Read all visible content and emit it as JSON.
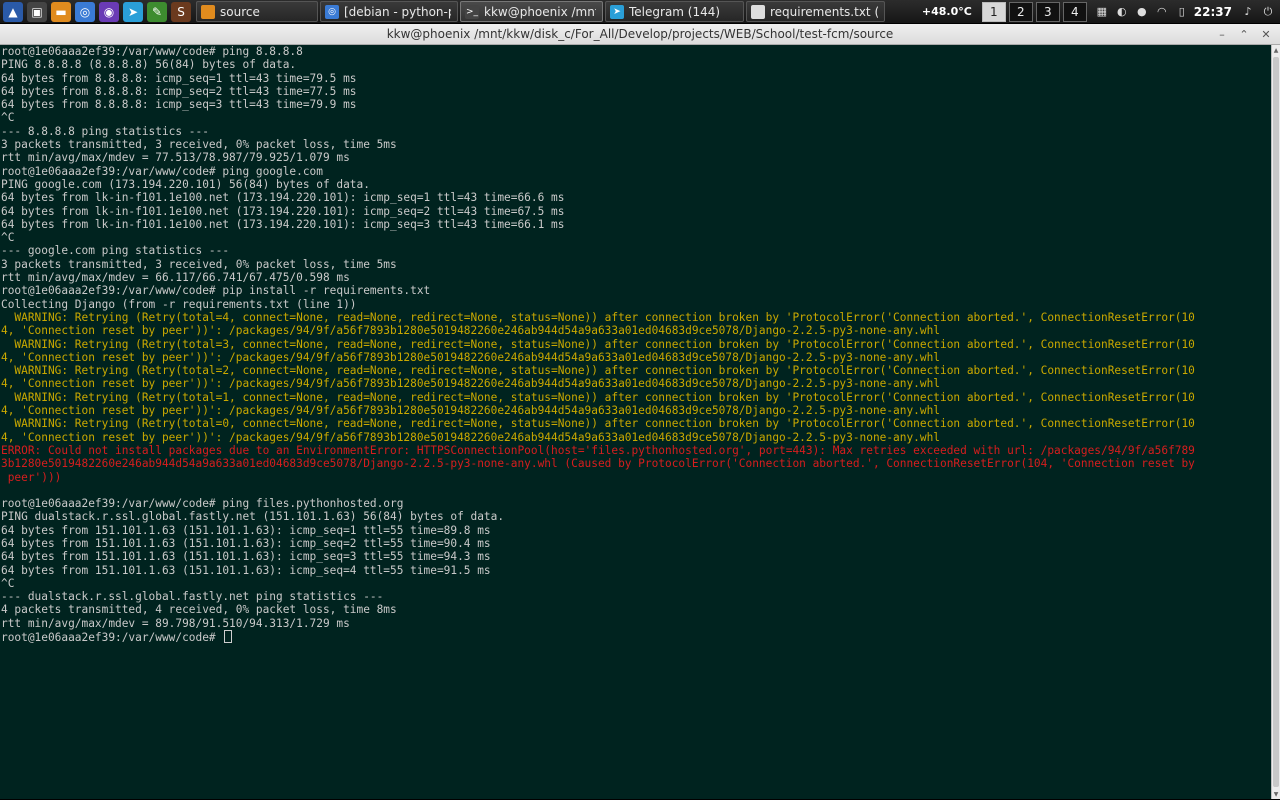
{
  "panel": {
    "launchers": [
      {
        "name": "menu-icon",
        "glyph": "▲",
        "color": "#2a5aa8"
      },
      {
        "name": "terminal-launcher-icon",
        "glyph": "▣",
        "color": "#444444"
      },
      {
        "name": "folder-icon",
        "glyph": "▬",
        "color": "#e08b1e"
      },
      {
        "name": "chromium-icon",
        "glyph": "◎",
        "color": "#3a7bd5"
      },
      {
        "name": "firefox-icon",
        "glyph": "◉",
        "color": "#6a3bb5"
      },
      {
        "name": "telegram-icon",
        "glyph": "➤",
        "color": "#2a9fd8"
      },
      {
        "name": "editor-icon",
        "glyph": "✎",
        "color": "#3d8c2f"
      },
      {
        "name": "sublime-icon",
        "glyph": "S",
        "color": "#6b3a1e"
      }
    ],
    "tasks": [
      {
        "name": "task-source",
        "label": "source",
        "icon": "folder-icon",
        "icon_color": "#e08b1e",
        "glyph": "",
        "active": false
      },
      {
        "name": "task-debian-python-pip",
        "label": "[debian - python-pip ...",
        "icon": "chromium-icon",
        "icon_color": "#3a7bd5",
        "glyph": "◎",
        "active": false
      },
      {
        "name": "task-terminal",
        "label": "kkw@phoenix /mnt/k...",
        "icon": "terminal-icon",
        "icon_color": "#444444",
        "glyph": ">_",
        "active": true
      },
      {
        "name": "task-telegram",
        "label": "Telegram (144)",
        "icon": "telegram-icon",
        "icon_color": "#2a9fd8",
        "glyph": "➤",
        "active": false
      },
      {
        "name": "task-requirements",
        "label": "requirements.txt (~/...",
        "icon": "document-icon",
        "icon_color": "#dddddd",
        "glyph": "",
        "active": false
      }
    ],
    "temperature": "+48.0°C",
    "workspaces": [
      "1",
      "2",
      "3",
      "4"
    ],
    "current_workspace": "1",
    "tray": [
      {
        "name": "flag-us-icon",
        "glyph": "▦"
      },
      {
        "name": "network-icon",
        "glyph": "◐"
      },
      {
        "name": "user-icon",
        "glyph": "●"
      },
      {
        "name": "wifi-icon",
        "glyph": "◠"
      },
      {
        "name": "battery-icon",
        "glyph": "▯"
      }
    ],
    "clock": "22:37",
    "tray_end": [
      {
        "name": "music-icon",
        "glyph": "♪"
      },
      {
        "name": "power-icon",
        "glyph": "⏻"
      }
    ]
  },
  "window": {
    "title": "kkw@phoenix /mnt/kkw/disk_c/For_All/Develop/projects/WEB/School/test-fcm/source",
    "minimize_glyph": "–",
    "maximize_glyph": "⌃",
    "close_glyph": "✕"
  },
  "terminal": {
    "lines": [
      {
        "text": "root@1e06aaa2ef39:/var/www/code# ping 8.8.8.8",
        "kind": "normal"
      },
      {
        "text": "PING 8.8.8.8 (8.8.8.8) 56(84) bytes of data.",
        "kind": "normal"
      },
      {
        "text": "64 bytes from 8.8.8.8: icmp_seq=1 ttl=43 time=79.5 ms",
        "kind": "normal"
      },
      {
        "text": "64 bytes from 8.8.8.8: icmp_seq=2 ttl=43 time=77.5 ms",
        "kind": "normal"
      },
      {
        "text": "64 bytes from 8.8.8.8: icmp_seq=3 ttl=43 time=79.9 ms",
        "kind": "normal"
      },
      {
        "text": "^C",
        "kind": "normal"
      },
      {
        "text": "--- 8.8.8.8 ping statistics ---",
        "kind": "normal"
      },
      {
        "text": "3 packets transmitted, 3 received, 0% packet loss, time 5ms",
        "kind": "normal"
      },
      {
        "text": "rtt min/avg/max/mdev = 77.513/78.987/79.925/1.079 ms",
        "kind": "normal"
      },
      {
        "text": "root@1e06aaa2ef39:/var/www/code# ping google.com",
        "kind": "normal"
      },
      {
        "text": "PING google.com (173.194.220.101) 56(84) bytes of data.",
        "kind": "normal"
      },
      {
        "text": "64 bytes from lk-in-f101.1e100.net (173.194.220.101): icmp_seq=1 ttl=43 time=66.6 ms",
        "kind": "normal"
      },
      {
        "text": "64 bytes from lk-in-f101.1e100.net (173.194.220.101): icmp_seq=2 ttl=43 time=67.5 ms",
        "kind": "normal"
      },
      {
        "text": "64 bytes from lk-in-f101.1e100.net (173.194.220.101): icmp_seq=3 ttl=43 time=66.1 ms",
        "kind": "normal"
      },
      {
        "text": "^C",
        "kind": "normal"
      },
      {
        "text": "--- google.com ping statistics ---",
        "kind": "normal"
      },
      {
        "text": "3 packets transmitted, 3 received, 0% packet loss, time 5ms",
        "kind": "normal"
      },
      {
        "text": "rtt min/avg/max/mdev = 66.117/66.741/67.475/0.598 ms",
        "kind": "normal"
      },
      {
        "text": "root@1e06aaa2ef39:/var/www/code# pip install -r requirements.txt",
        "kind": "normal"
      },
      {
        "text": "Collecting Django (from -r requirements.txt (line 1))",
        "kind": "normal"
      },
      {
        "text": "  WARNING: Retrying (Retry(total=4, connect=None, read=None, redirect=None, status=None)) after connection broken by 'ProtocolError('Connection aborted.', ConnectionResetError(10",
        "kind": "warn"
      },
      {
        "text": "4, 'Connection reset by peer'))': /packages/94/9f/a56f7893b1280e5019482260e246ab944d54a9a633a01ed04683d9ce5078/Django-2.2.5-py3-none-any.whl",
        "kind": "warn"
      },
      {
        "text": "  WARNING: Retrying (Retry(total=3, connect=None, read=None, redirect=None, status=None)) after connection broken by 'ProtocolError('Connection aborted.', ConnectionResetError(10",
        "kind": "warn"
      },
      {
        "text": "4, 'Connection reset by peer'))': /packages/94/9f/a56f7893b1280e5019482260e246ab944d54a9a633a01ed04683d9ce5078/Django-2.2.5-py3-none-any.whl",
        "kind": "warn"
      },
      {
        "text": "  WARNING: Retrying (Retry(total=2, connect=None, read=None, redirect=None, status=None)) after connection broken by 'ProtocolError('Connection aborted.', ConnectionResetError(10",
        "kind": "warn"
      },
      {
        "text": "4, 'Connection reset by peer'))': /packages/94/9f/a56f7893b1280e5019482260e246ab944d54a9a633a01ed04683d9ce5078/Django-2.2.5-py3-none-any.whl",
        "kind": "warn"
      },
      {
        "text": "  WARNING: Retrying (Retry(total=1, connect=None, read=None, redirect=None, status=None)) after connection broken by 'ProtocolError('Connection aborted.', ConnectionResetError(10",
        "kind": "warn"
      },
      {
        "text": "4, 'Connection reset by peer'))': /packages/94/9f/a56f7893b1280e5019482260e246ab944d54a9a633a01ed04683d9ce5078/Django-2.2.5-py3-none-any.whl",
        "kind": "warn"
      },
      {
        "text": "  WARNING: Retrying (Retry(total=0, connect=None, read=None, redirect=None, status=None)) after connection broken by 'ProtocolError('Connection aborted.', ConnectionResetError(10",
        "kind": "warn"
      },
      {
        "text": "4, 'Connection reset by peer'))': /packages/94/9f/a56f7893b1280e5019482260e246ab944d54a9a633a01ed04683d9ce5078/Django-2.2.5-py3-none-any.whl",
        "kind": "warn"
      },
      {
        "text": "ERROR: Could not install packages due to an EnvironmentError: HTTPSConnectionPool(host='files.pythonhosted.org', port=443): Max retries exceeded with url: /packages/94/9f/a56f789",
        "kind": "err"
      },
      {
        "text": "3b1280e5019482260e246ab944d54a9a633a01ed04683d9ce5078/Django-2.2.5-py3-none-any.whl (Caused by ProtocolError('Connection aborted.', ConnectionResetError(104, 'Connection reset by",
        "kind": "err"
      },
      {
        "text": " peer')))",
        "kind": "err"
      },
      {
        "text": "",
        "kind": "normal"
      },
      {
        "text": "root@1e06aaa2ef39:/var/www/code# ping files.pythonhosted.org",
        "kind": "normal"
      },
      {
        "text": "PING dualstack.r.ssl.global.fastly.net (151.101.1.63) 56(84) bytes of data.",
        "kind": "normal"
      },
      {
        "text": "64 bytes from 151.101.1.63 (151.101.1.63): icmp_seq=1 ttl=55 time=89.8 ms",
        "kind": "normal"
      },
      {
        "text": "64 bytes from 151.101.1.63 (151.101.1.63): icmp_seq=2 ttl=55 time=90.4 ms",
        "kind": "normal"
      },
      {
        "text": "64 bytes from 151.101.1.63 (151.101.1.63): icmp_seq=3 ttl=55 time=94.3 ms",
        "kind": "normal"
      },
      {
        "text": "64 bytes from 151.101.1.63 (151.101.1.63): icmp_seq=4 ttl=55 time=91.5 ms",
        "kind": "normal"
      },
      {
        "text": "^C",
        "kind": "normal"
      },
      {
        "text": "--- dualstack.r.ssl.global.fastly.net ping statistics ---",
        "kind": "normal"
      },
      {
        "text": "4 packets transmitted, 4 received, 0% packet loss, time 8ms",
        "kind": "normal"
      },
      {
        "text": "rtt min/avg/max/mdev = 89.798/91.510/94.313/1.729 ms",
        "kind": "normal"
      }
    ],
    "prompt": "root@1e06aaa2ef39:/var/www/code# ",
    "colors": {
      "background": "#00231f",
      "text": "#c9c9c9",
      "warning": "#c9a800",
      "error": "#d61e1e"
    }
  }
}
